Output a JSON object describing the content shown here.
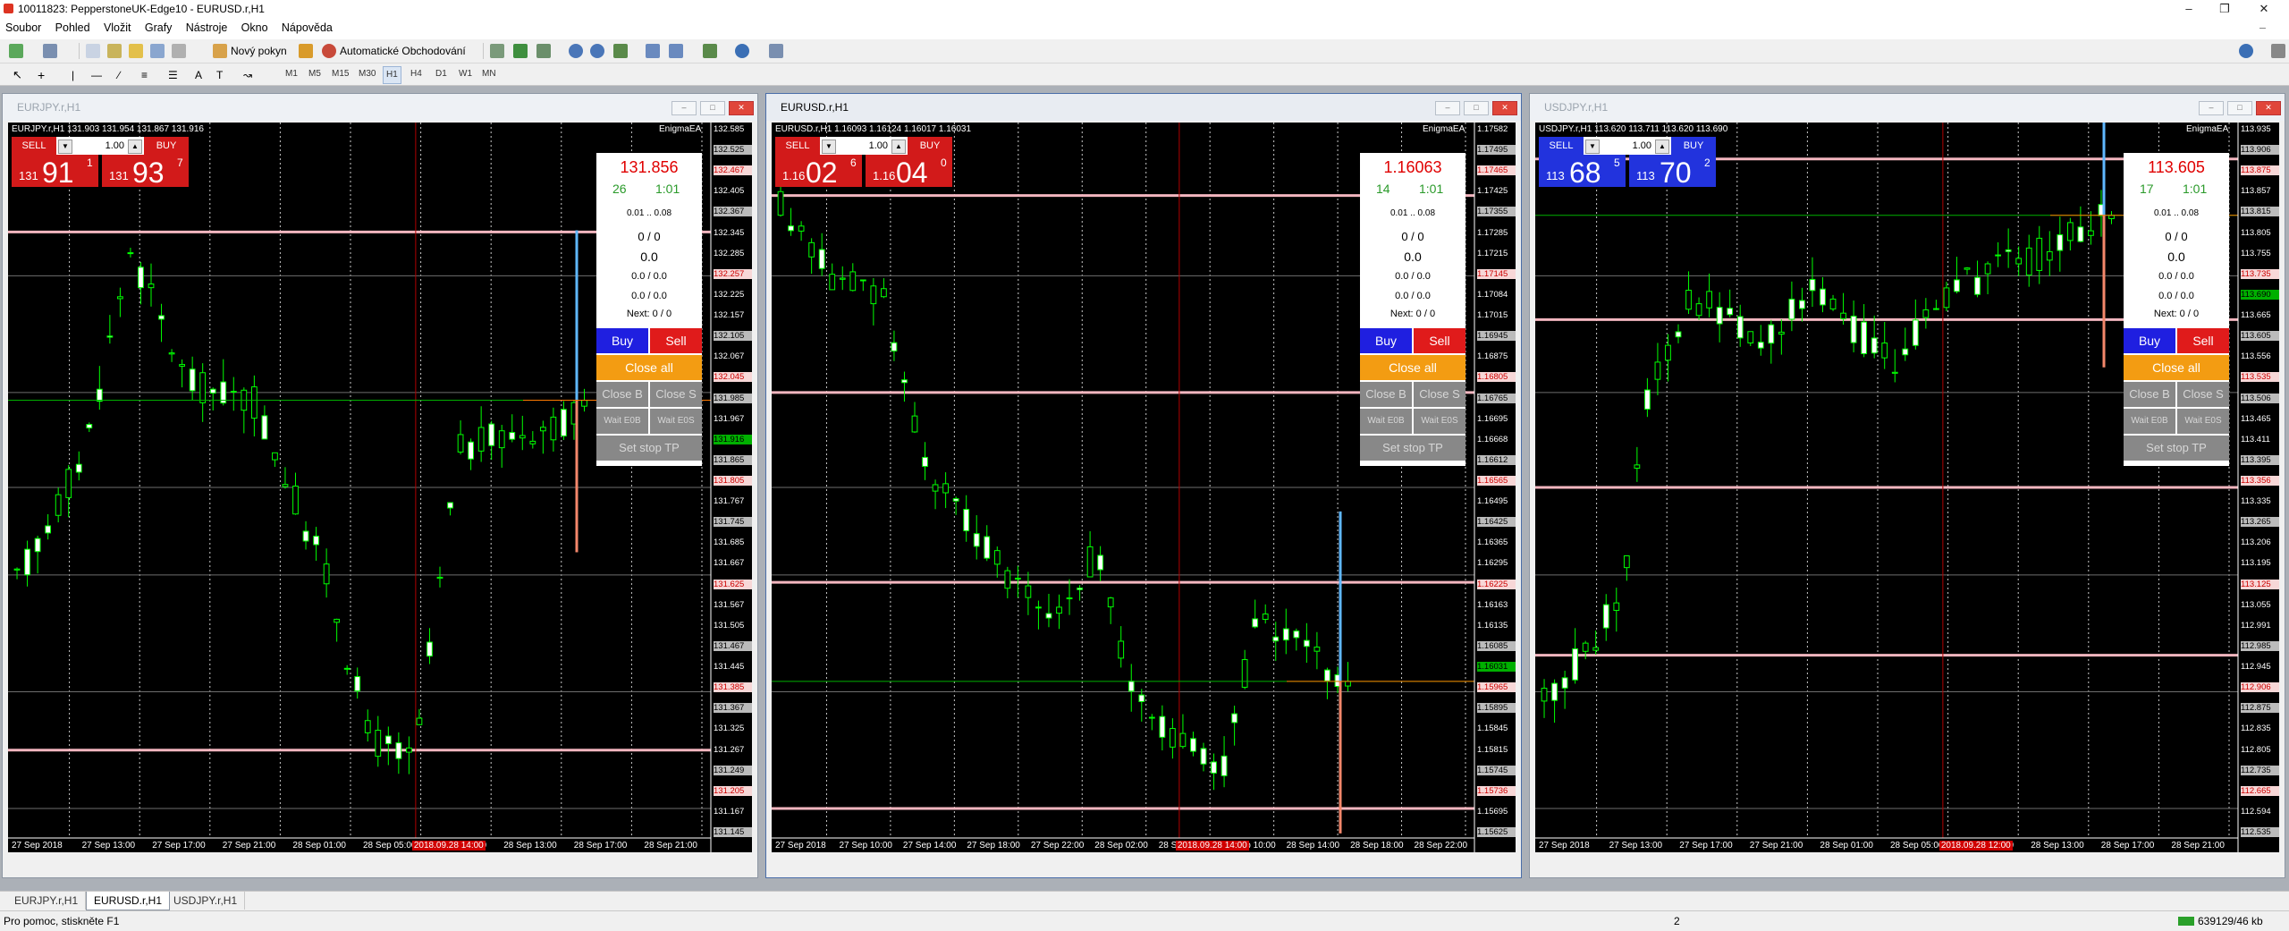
{
  "app": {
    "title": "10011823: PepperstoneUK-Edge10 - EURUSD.r,H1",
    "menu": [
      "Soubor",
      "Pohled",
      "Vložit",
      "Grafy",
      "Nástroje",
      "Okno",
      "Nápověda"
    ],
    "toolbar": {
      "new_order": "Nový pokyn",
      "auto_trading": "Automatické Obchodování"
    },
    "timeframes": [
      "M1",
      "M5",
      "M15",
      "M30",
      "H1",
      "H4",
      "D1",
      "W1",
      "MN"
    ],
    "active_timeframe": "H1"
  },
  "charts": [
    {
      "window_title": "EURJPY.r,H1",
      "header": "EURJPY.r,H1  131.903 131.954 131.867 131.916",
      "ea_label": "EnigmaEA",
      "sell_label": "SELL",
      "buy_label": "BUY",
      "lot": "1.00",
      "bid_prefix": "131",
      "bid_big": "91",
      "bid_sup": "1",
      "ask_prefix": "131",
      "ask_big": "93",
      "ask_sup": "7",
      "panel_color": "#d21a1a",
      "ea": {
        "price": "131.856",
        "count": "26",
        "ratio": "1:01",
        "range": "0.01 .. 0.08",
        "r1": "0 / 0",
        "r2": "0.0",
        "r3": "0.0 / 0.0",
        "r4": "0.0 / 0.0",
        "next": "Next: 0 / 0"
      },
      "y_ticks": [
        "132.585",
        "132.525",
        "132.467",
        "132.405",
        "132.367",
        "132.345",
        "132.285",
        "132.257",
        "132.225",
        "132.157",
        "132.105",
        "132.067",
        "132.045",
        "131.985",
        "131.967",
        "131.916",
        "131.865",
        "131.805",
        "131.767",
        "131.745",
        "131.685",
        "131.667",
        "131.625",
        "131.567",
        "131.505",
        "131.467",
        "131.445",
        "131.385",
        "131.367",
        "131.325",
        "131.267",
        "131.249",
        "131.205",
        "131.167",
        "131.145"
      ],
      "x_ticks": [
        "27 Sep 2018",
        "27 Sep 13:00",
        "27 Sep 17:00",
        "27 Sep 21:00",
        "28 Sep 01:00",
        "28 Sep 05:00",
        "28 Sep 09:00",
        "28 Sep 13:00",
        "28 Sep 17:00",
        "28 Sep 21:00"
      ],
      "marker_label": "2018.09.28 14:00",
      "last_price": "131.916"
    },
    {
      "window_title": "EURUSD.r,H1",
      "header": "EURUSD.r,H1  1.16093 1.16124 1.16017 1.16031",
      "ea_label": "EnigmaEA",
      "sell_label": "SELL",
      "buy_label": "BUY",
      "lot": "1.00",
      "bid_prefix": "1.16",
      "bid_big": "02",
      "bid_sup": "6",
      "ask_prefix": "1.16",
      "ask_big": "04",
      "ask_sup": "0",
      "panel_color": "#d21a1a",
      "ea": {
        "price": "1.16063",
        "count": "14",
        "ratio": "1:01",
        "range": "0.01 .. 0.08",
        "r1": "0 / 0",
        "r2": "0.0",
        "r3": "0.0 / 0.0",
        "r4": "0.0 / 0.0",
        "next": "Next: 0 / 0"
      },
      "y_ticks": [
        "1.17582",
        "1.17495",
        "1.17465",
        "1.17425",
        "1.17355",
        "1.17285",
        "1.17215",
        "1.17145",
        "1.17084",
        "1.17015",
        "1.16945",
        "1.16875",
        "1.16805",
        "1.16765",
        "1.16695",
        "1.16668",
        "1.16612",
        "1.16565",
        "1.16495",
        "1.16425",
        "1.16365",
        "1.16295",
        "1.16225",
        "1.16163",
        "1.16135",
        "1.16085",
        "1.16031",
        "1.15965",
        "1.15895",
        "1.15845",
        "1.15815",
        "1.15745",
        "1.15736",
        "1.15695",
        "1.15625"
      ],
      "x_ticks": [
        "27 Sep 2018",
        "27 Sep 10:00",
        "27 Sep 14:00",
        "27 Sep 18:00",
        "27 Sep 22:00",
        "28 Sep 02:00",
        "28 Sep 06:00",
        "28 Sep 10:00",
        "28 Sep 14:00",
        "28 Sep 18:00",
        "28 Sep 22:00"
      ],
      "marker_label": "2018.09.28 14:00",
      "last_price": "1.16031"
    },
    {
      "window_title": "USDJPY.r,H1",
      "header": "USDJPY.r,H1  113.620 113.711 113.620 113.690",
      "ea_label": "EnigmaEA",
      "sell_label": "SELL",
      "buy_label": "BUY",
      "lot": "1.00",
      "bid_prefix": "113",
      "bid_big": "68",
      "bid_sup": "5",
      "ask_prefix": "113",
      "ask_big": "70",
      "ask_sup": "2",
      "panel_color": "#2233dd",
      "ea": {
        "price": "113.605",
        "count": "17",
        "ratio": "1:01",
        "range": "0.01 .. 0.08",
        "r1": "0 / 0",
        "r2": "0.0",
        "r3": "0.0 / 0.0",
        "r4": "0.0 / 0.0",
        "next": "Next: 0 / 0"
      },
      "y_ticks": [
        "113.935",
        "113.906",
        "113.875",
        "113.857",
        "113.815",
        "113.805",
        "113.755",
        "113.735",
        "113.690",
        "113.665",
        "113.605",
        "113.556",
        "113.535",
        "113.506",
        "113.465",
        "113.411",
        "113.395",
        "113.356",
        "113.335",
        "113.265",
        "113.206",
        "113.195",
        "113.125",
        "113.055",
        "112.991",
        "112.985",
        "112.945",
        "112.906",
        "112.875",
        "112.835",
        "112.805",
        "112.735",
        "112.665",
        "112.594",
        "112.535"
      ],
      "x_ticks": [
        "27 Sep 2018",
        "27 Sep 13:00",
        "27 Sep 17:00",
        "27 Sep 21:00",
        "28 Sep 01:00",
        "28 Sep 05:00",
        "28 Sep 09:00",
        "28 Sep 13:00",
        "28 Sep 17:00",
        "28 Sep 21:00"
      ],
      "marker_label": "2018.09.28 12:00",
      "last_price": "113.690"
    }
  ],
  "ea_buttons": {
    "buy": "Buy",
    "sell": "Sell",
    "close_all": "Close all",
    "close_b": "Close B",
    "close_s": "Close S",
    "wait_eob": "Wait E0B",
    "wait_eos": "Wait E0S",
    "set_stop": "Set stop TP"
  },
  "tabs": [
    "EURJPY.r,H1",
    "EURUSD.r,H1",
    "USDJPY.r,H1"
  ],
  "active_tab": "EURUSD.r,H1",
  "status": {
    "help": "Pro pomoc, stiskněte F1",
    "value": "2",
    "connection": "639129/46 kb"
  }
}
